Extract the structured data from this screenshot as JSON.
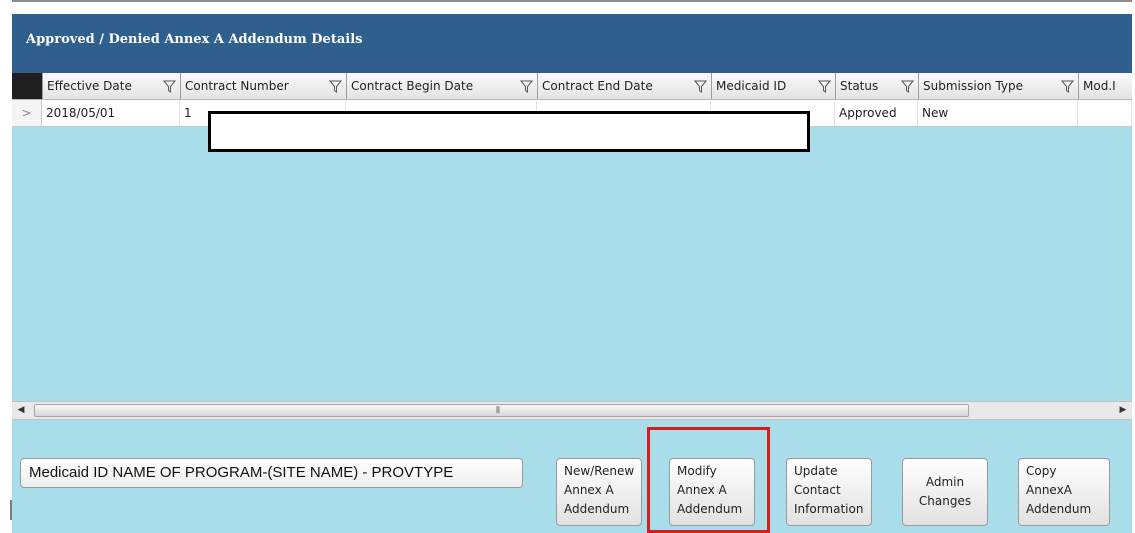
{
  "panel": {
    "title": "Approved / Denied Annex A Addendum Details"
  },
  "grid": {
    "columns": [
      {
        "label": "Effective Date",
        "filter_icon": "funnel-filter-icon"
      },
      {
        "label": "Contract Number",
        "filter_icon": "funnel-filter-icon"
      },
      {
        "label": "Contract Begin Date",
        "filter_icon": "funnel-filter-icon"
      },
      {
        "label": "Contract End Date",
        "filter_icon": "funnel-filter-icon"
      },
      {
        "label": "Medicaid ID",
        "filter_icon": "funnel-filter-icon"
      },
      {
        "label": "Status",
        "filter_icon": "funnel-filter-icon"
      },
      {
        "label": "Submission Type",
        "filter_icon": "funnel-filter-icon"
      },
      {
        "label": "Mod.I",
        "filter_icon": ""
      }
    ],
    "rows": [
      {
        "indicator": ">",
        "effective_date": "2018/05/01",
        "contract_number": "1",
        "contract_begin_date": "",
        "contract_end_date": "",
        "medicaid_id": "",
        "status": "Approved",
        "submission_type": "New",
        "mod": ""
      }
    ]
  },
  "scrollbar": {
    "left_arrow": "◀",
    "right_arrow": "▶",
    "grip": "⦀"
  },
  "program_field": {
    "value": "Medicaid ID NAME OF PROGRAM-(SITE NAME) - PROVTYPE"
  },
  "buttons": {
    "new_renew": [
      "New/Renew",
      "Annex A",
      "Addendum"
    ],
    "modify": [
      "Modify",
      "Annex A",
      "Addendum"
    ],
    "update_contact": [
      "Update",
      "Contact",
      "Information"
    ],
    "admin_changes": [
      "Admin",
      "Changes"
    ],
    "copy": [
      "Copy",
      "AnnexA",
      "Addendum"
    ]
  },
  "colors": {
    "header_bg": "#2f5f8c",
    "panel_bg": "#a9dde9",
    "highlight": "#d02020"
  }
}
